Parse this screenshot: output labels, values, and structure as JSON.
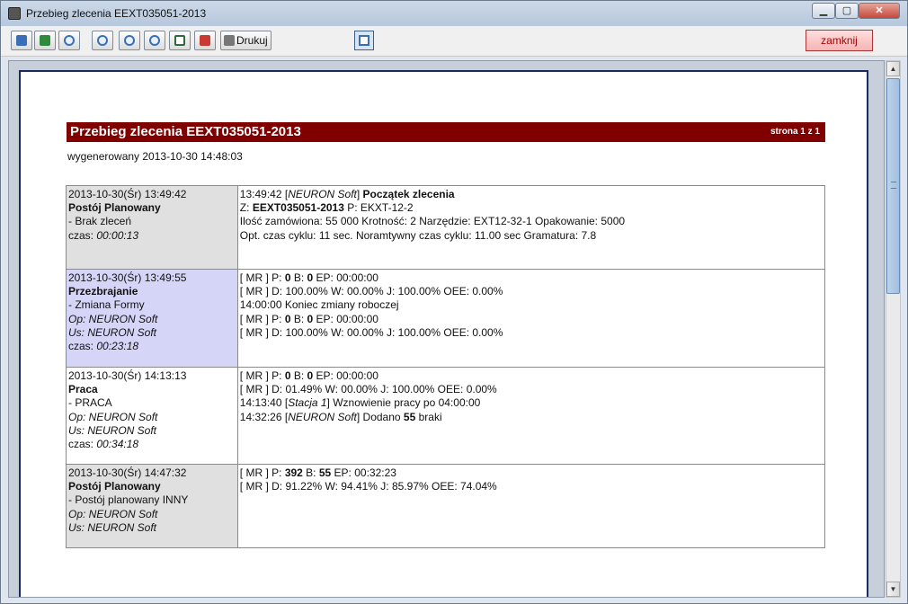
{
  "window": {
    "title": "Przebieg zlecenia EEXT035051-2013",
    "minimize": "▁",
    "maximize": "▢",
    "close": "✕"
  },
  "toolbar": {
    "print_label": "Drukuj",
    "close_label": "zamknij"
  },
  "report": {
    "title": "Przebieg zlecenia EEXT035051-2013",
    "page_info": "strona 1 z 1",
    "generated": "wygenerowany 2013-10-30 14:48:03"
  },
  "rows": [
    {
      "left": {
        "timestamp": "2013-10-30(Śr) 13:49:42",
        "state": "Postój Planowany",
        "reason": "- Brak zleceń",
        "time_label": "czas: ",
        "time_value": "00:00:13"
      },
      "right": {
        "r1_time": "13:49:42",
        "r1_source": "NEURON Soft",
        "r1_event": "Początek zlecenia",
        "r2_z_label": "Z:",
        "r2_z_value": "EEXT035051-2013",
        "r2_p": "P: EKXT-12-2",
        "r3": "Ilość zamówiona:  55 000  Krotność: 2  Narzędzie: EXT12-32-1   Opakowanie: 5000",
        "r4": "Opt. czas cyklu: 11 sec.  Noramtywny czas cyklu: 11.00 sec  Gramatura: 7.8"
      }
    },
    {
      "left": {
        "timestamp": "2013-10-30(Śr) 13:49:55",
        "state": "Przezbrajanie",
        "reason": "- Zmiana Formy",
        "op": "Op: NEURON Soft",
        "us": "Us: NEURON Soft",
        "time_label": "czas: ",
        "time_value": "00:23:18"
      },
      "right": {
        "a_prefix": "[ MR ]  P: ",
        "a_p": "0",
        "a_b_label": "   B: ",
        "a_b": "0",
        "a_ep": "   EP: 00:00:00",
        "b": "[ MR ]  D: 100.00%   W: 00.00%   J: 100.00%   OEE: 0.00%",
        "c": "14:00:00 Koniec zmiany roboczej",
        "d_prefix": "[ MR ]  P: ",
        "d_p": "0",
        "d_b_label": "   B: ",
        "d_b": "0",
        "d_ep": "   EP: 00:00:00",
        "e": "[ MR ]  D: 100.00%   W: 00.00%   J: 100.00%   OEE: 0.00%"
      }
    },
    {
      "left": {
        "timestamp": "2013-10-30(Śr) 14:13:13",
        "state": "Praca",
        "reason": "- PRACA",
        "op": "Op: NEURON Soft",
        "us": "Us: NEURON Soft",
        "time_label": "czas: ",
        "time_value": "00:34:18"
      },
      "right": {
        "a_prefix": "[ MR ]  P: ",
        "a_p": "0",
        "a_b_label": "   B: ",
        "a_b": "0",
        "a_ep": "   EP: 00:00:00",
        "b": "[ MR ]  D: 01.49%   W: 00.00%   J: 100.00%   OEE: 0.00%",
        "c_time": "14:13:40  [",
        "c_source": "Stacja 1",
        "c_text": "]   Wznowienie pracy po 04:00:00",
        "d_time": "14:32:26  [",
        "d_source": "NEURON Soft",
        "d_text": "]   Dodano ",
        "d_count": "55",
        "d_suffix": " braki"
      }
    },
    {
      "left": {
        "timestamp": "2013-10-30(Śr) 14:47:32",
        "state": "Postój Planowany",
        "reason": "- Postój planowany INNY",
        "op": "Op: NEURON Soft",
        "us": "Us: NEURON Soft"
      },
      "right": {
        "a_prefix": "[ MR ]  P: ",
        "a_p": "392",
        "a_b_label": "   B: ",
        "a_b": "55",
        "a_ep": "   EP: 00:32:23",
        "b": "[ MR ]  D: 91.22%   W: 94.41%   J: 85.97%   OEE: 74.04%"
      }
    }
  ],
  "icons": {
    "toolbar": [
      "first-page-icon",
      "prev-page-icon",
      "zoom-fit-icon",
      "zoom-page-icon",
      "zoom-out-icon",
      "zoom-in-icon",
      "check-icon",
      "pdf-export-icon",
      "printer-icon",
      "view-mode-icon"
    ]
  },
  "colors": {
    "header_bar": "#800000",
    "row_gray": "#e0e0e0",
    "row_blue": "#d5d5f8",
    "close_button": "#f4b5b5"
  }
}
